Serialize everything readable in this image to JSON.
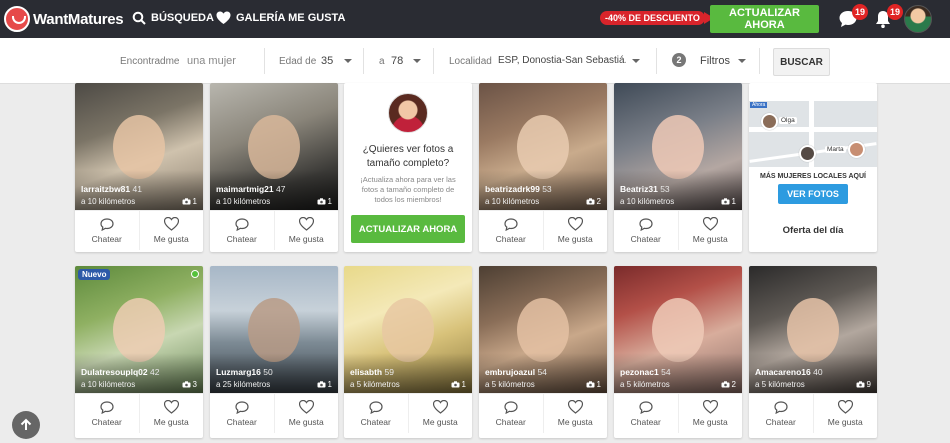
{
  "brand": {
    "name": "WantMatures"
  },
  "nav": {
    "search_label": "BÚSQUEDA",
    "gallery_label": "GALERÍA ME GUSTA",
    "discount": "-40% DE DESCUENTO",
    "upgrade_label": "ACTUALIZAR AHORA",
    "messages_count": "19",
    "notifications_count": "19"
  },
  "filters": {
    "find_label": "Encontradme",
    "find_value": "una mujer",
    "age_label": "Edad de",
    "age_from": "35",
    "age_to_label": "a",
    "age_to": "78",
    "location_label": "Localidad",
    "location_value": "ESP, Donostia-San Sebastiá...",
    "filters_count": "2",
    "filters_label": "Filtros",
    "search_button": "BUSCAR"
  },
  "labels": {
    "chat": "Chatear",
    "like": "Me gusta"
  },
  "profiles": [
    {
      "name": "larraitzbw81",
      "age": "41",
      "distance": "a 10 kilómetros",
      "photos": "1",
      "bg": "linear-gradient(160deg,#4d4a45 0%,#7b7466 35%,#cfc2ad 60%,#8c8070 100%)",
      "face": "#e6c4a4"
    },
    {
      "name": "maimartmig21",
      "age": "47",
      "distance": "a 10 kilómetros",
      "photos": "1",
      "bg": "linear-gradient(160deg,#b8b6ae 0%,#8a857a 40%,#3b3a37 75%,#1f1f1e 100%)",
      "face": "#d8b79a"
    },
    {
      "name": "beatrizadrk99",
      "age": "53",
      "distance": "a 10 kilómetros",
      "photos": "2",
      "bg": "linear-gradient(160deg,#6b5346 0%,#9a7a62 35%,#c9ab8c 60%,#7d6654 100%)",
      "face": "#e9cbb0"
    },
    {
      "name": "Beatriz31",
      "age": "53",
      "distance": "a 10 kilómetros",
      "photos": "1",
      "bg": "linear-gradient(160deg,#3f4a57 0%,#7a7f88 40%,#b4a7a2 70%,#5c5151 100%)",
      "face": "#efc9b6"
    },
    {
      "name": "Dulatresouplq02",
      "age": "42",
      "distance": "a 10 kilómetros",
      "photos": "3",
      "bg": "linear-gradient(160deg,#5d8a3c 0%,#8fb062 35%,#c8d7b2 60%,#6d8a5a 100%)",
      "face": "#edcdb3",
      "isNew": true,
      "online": true
    },
    {
      "name": "Luzmarg16",
      "age": "50",
      "distance": "a 25 kilómetros",
      "photos": "1",
      "bg": "linear-gradient(180deg,#a7b7c7 0%,#c7d1d9 35%,#7d8b95 60%,#3b434a 100%)",
      "face": "#b89b86"
    },
    {
      "name": "elisabth",
      "age": "59",
      "distance": "a 5 kilómetros",
      "photos": "1",
      "bg": "linear-gradient(160deg,#e8d98a 0%,#f4e9b8 35%,#d8c27a 60%,#8d7a3f 100%)",
      "face": "#e7c8a2"
    },
    {
      "name": "embrujoazul",
      "age": "54",
      "distance": "a 5 kilómetros",
      "photos": "1",
      "bg": "linear-gradient(160deg,#4d3f33 0%,#8a6e58 35%,#c9a88a 60%,#6e5644 100%)",
      "face": "#e4c1a3"
    },
    {
      "name": "pezonac1",
      "age": "54",
      "distance": "a 5 kilómetros",
      "photos": "2",
      "bg": "linear-gradient(160deg,#7a2b2b 0%,#b35048 30%,#d8ad9c 60%,#8d6f68 100%)",
      "face": "#eecab7"
    },
    {
      "name": "Amacareno16",
      "age": "40",
      "distance": "a 5 kilómetros",
      "photos": "9",
      "bg": "linear-gradient(160deg,#2b2a2a 0%,#5f5a55 35%,#b2a79e 60%,#4a423d 100%)",
      "face": "#e6c3a8"
    }
  ],
  "promo": {
    "title": "¿Quieres ver fotos a tamaño completo?",
    "body": "¡Actualiza ahora para ver las fotos a tamaño completo de todos los miembros!",
    "button": "ACTUALIZAR AHORA"
  },
  "map_card": {
    "tag": "Ahora",
    "pin1": "Olga",
    "pin2": "Marta",
    "caption": "MÁS MUJERES LOCALES AQUÍ",
    "button": "VER FOTOS",
    "offer": "Oferta del día"
  },
  "new_badge": "Nuevo",
  "colors": {
    "accent_green": "#59ba3f",
    "nav_bg": "#2a2c33",
    "badge_red": "#e02424",
    "blue_button": "#2d9be0"
  }
}
